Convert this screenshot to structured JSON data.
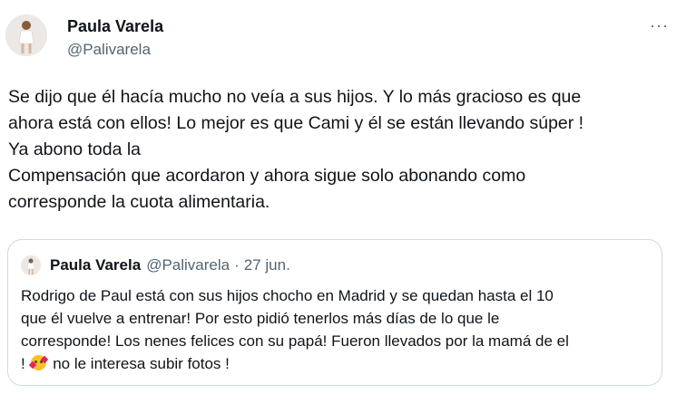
{
  "tweet": {
    "author_name": "Paula Varela",
    "author_handle": "@Palivarela",
    "more_label": "···",
    "text_lines": [
      "Se dijo que él hacía mucho no veía a sus hijos. Y lo más gracioso es que",
      "ahora está con ellos!  Lo mejor es que Cami y él se están llevando súper !",
      "Ya abono toda la",
      "Compensación que acordaron y ahora sigue solo abonando como",
      "corresponde la cuota alimentaria."
    ]
  },
  "quoted": {
    "author_name": "Paula Varela",
    "author_handle": "@Palivarela",
    "separator": "·",
    "date": "27 jun.",
    "lines": [
      "Rodrigo de Paul está con sus hijos chocho en Madrid y se quedan hasta el 10",
      "que él vuelve a entrenar! Por esto pidió tenerlos más días de lo que le",
      "corresponde! Los nenes felices con su papá! Fueron llevados por la mamá de el"
    ],
    "last_line_prefix": "!",
    "emoji_name": "smiling-face-with-hearts",
    "last_line_suffix": "no le interesa subir fotos !"
  }
}
